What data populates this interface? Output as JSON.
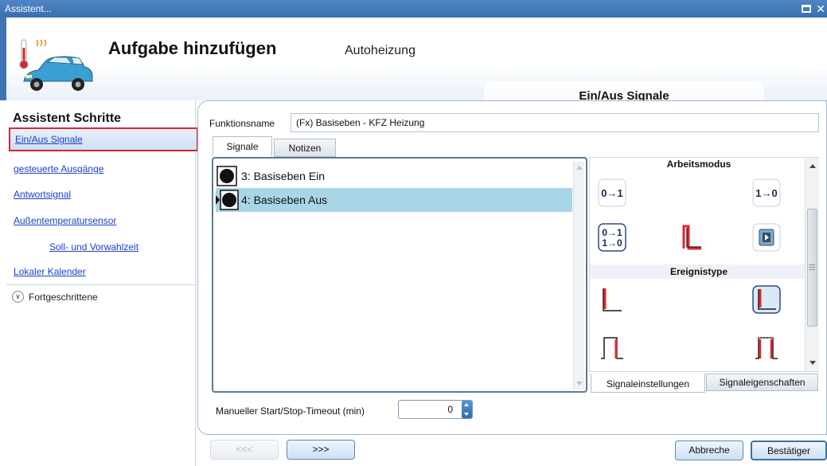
{
  "window": {
    "title": "Assistent..."
  },
  "header": {
    "title": "Aufgabe hinzufügen",
    "subtitle": "Autoheizung",
    "step_tab": "Ein/Aus Signale"
  },
  "sidebar": {
    "title": "Assistent Schritte",
    "items": [
      {
        "label": "Ein/Aus Signale"
      },
      {
        "label": "gesteuerte Ausgänge"
      },
      {
        "label": "Antwortsignal"
      },
      {
        "label": "Außentemperatursensor"
      },
      {
        "label": "Soll- und Vorwahlzeit"
      },
      {
        "label": "Lokaler Kalender"
      }
    ],
    "advanced": "Fortgeschrittene"
  },
  "form": {
    "function_name_label": "Funktionsname",
    "function_name_value": "(Fx) Basiseben - KFZ Heizung",
    "tabs": [
      "Signale",
      "Notizen"
    ],
    "signals": [
      {
        "label": "3: Basiseben Ein"
      },
      {
        "label": "4: Basiseben Aus"
      }
    ],
    "timeout_label": "Manueller Start/Stop-Timeout (min)",
    "timeout_value": "0"
  },
  "right_panel": {
    "mode_title": "Arbeitsmodus",
    "event_title": "Ereignistype",
    "mode_buttons": [
      {
        "label": "0→1",
        "icon": "rising-edge-icon"
      },
      {
        "label": "1→0",
        "icon": "falling-edge-icon"
      },
      {
        "label": "0→1 1→0",
        "icon": "both-edges-icon"
      },
      {
        "label": "",
        "icon": "pulse-icon"
      },
      {
        "label": "",
        "icon": "toggle-icon"
      }
    ],
    "bottom_tabs": [
      "Signaleinstellungen",
      "Signaleigenschaften"
    ]
  },
  "footer": {
    "prev_label": "<<<",
    "next_label": ">>>",
    "cancel_label": "Abbreche",
    "confirm_label": "Bestätiger"
  },
  "colors": {
    "accent": "#3f74b3",
    "selection": "#a9d6e6",
    "highlight_border": "#d9262f",
    "link": "#1a3fcc",
    "signal_red": "#e0262e"
  }
}
